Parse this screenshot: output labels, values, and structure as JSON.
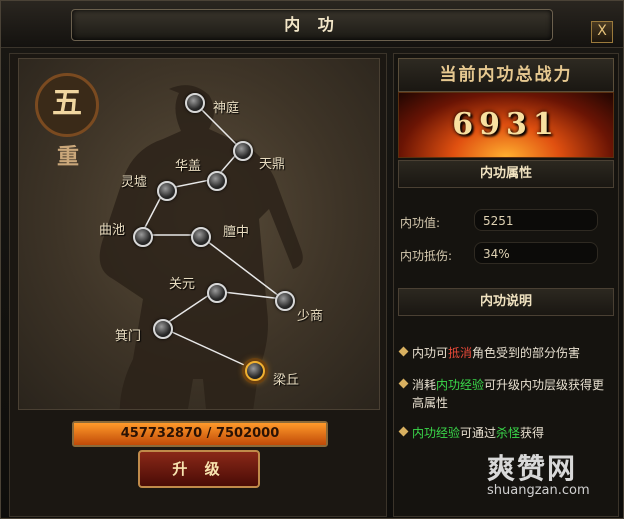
{
  "window": {
    "title": "内 功",
    "close_label": "X"
  },
  "level": {
    "badge": "五",
    "sub": "重"
  },
  "meridian_nodes": [
    {
      "name": "神庭",
      "active": false
    },
    {
      "name": "天鼎",
      "active": false
    },
    {
      "name": "华盖",
      "active": false
    },
    {
      "name": "灵墟",
      "active": false
    },
    {
      "name": "曲池",
      "active": false
    },
    {
      "name": "膻中",
      "active": false
    },
    {
      "name": "关元",
      "active": false
    },
    {
      "name": "少商",
      "active": false
    },
    {
      "name": "箕门",
      "active": false
    },
    {
      "name": "梁丘",
      "active": true
    }
  ],
  "experience": {
    "text": "457732870 / 7502000",
    "progress": 1.0
  },
  "upgrade_label": "升 级",
  "power": {
    "heading": "当前内功总战力",
    "value": "6931"
  },
  "attributes": {
    "heading": "内功属性",
    "rows": [
      {
        "label": "内功值:",
        "value": "5251"
      },
      {
        "label": "内功抵伤:",
        "value": "34%"
      }
    ]
  },
  "description": {
    "heading": "内功说明",
    "line1": {
      "a": "内功可",
      "b": "抵消",
      "c": "角色受到的部分伤害"
    },
    "line2": {
      "a": "消耗",
      "b": "内功经验",
      "c": "可升级内功层级获得更高属性"
    },
    "line3": {
      "a": "内功经验",
      "b": "可通过",
      "c": "杀怪",
      "d": "获得"
    }
  },
  "watermark": {
    "brand": "爽赞网",
    "url": "shuangzan.com"
  },
  "colors": {
    "highlight_red": "#e84a3a",
    "highlight_green": "#3ad84a",
    "exp_bar": "#ff9a2a"
  }
}
